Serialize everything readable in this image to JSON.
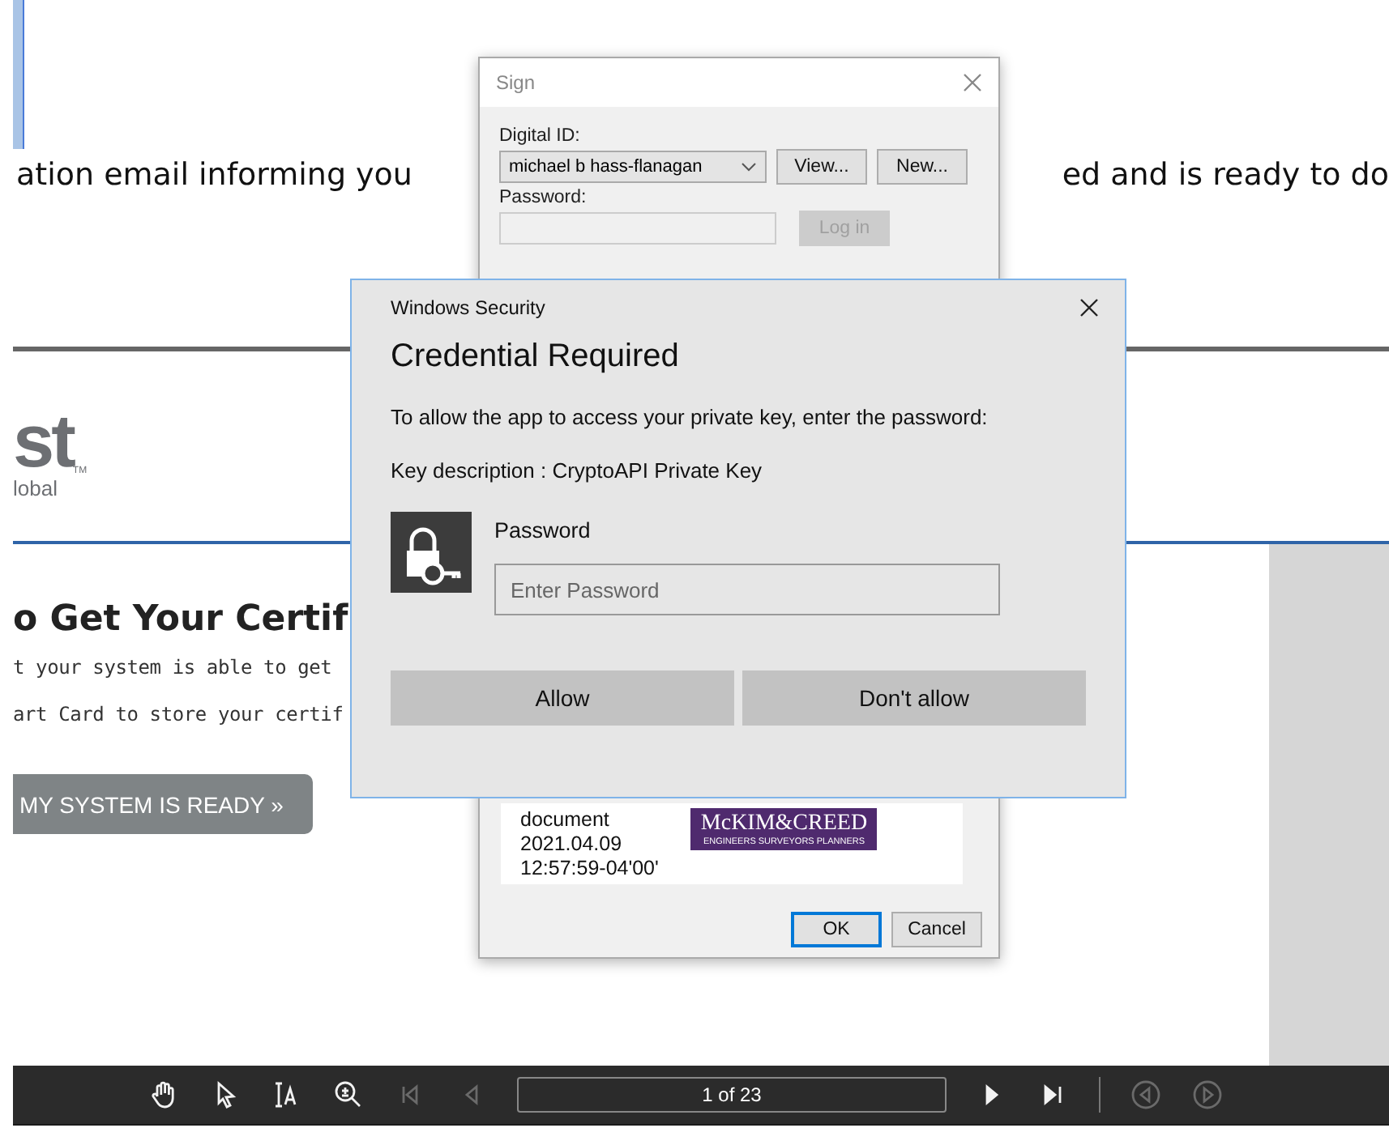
{
  "document": {
    "intro_left": "ation email informing you",
    "intro_right": "ed and is ready to do",
    "logo": {
      "mark": "st",
      "trademark": "TM",
      "tagline": "lobal"
    },
    "heading": "o Get Your Certif",
    "paragraphs": [
      "t your system is able to get",
      "art Card to store your certif"
    ],
    "ready_button": "MY SYSTEM IS READY »"
  },
  "sign_dialog": {
    "title": "Sign",
    "digital_id_label": "Digital ID:",
    "digital_id": "michael b hass-flanagan",
    "id_buttons": [
      {
        "label": "View...",
        "disabled": false
      },
      {
        "label": "New...",
        "disabled": false
      }
    ],
    "password_label": "Password:",
    "login_button": {
      "label": "Log in",
      "disabled": true
    },
    "signature_preview": {
      "lines": [
        "document",
        "2021.04.09",
        "12:57:59-04'00'"
      ],
      "logo_name": "McKIM&CREED",
      "logo_tagline": "ENGINEERS SURVEYORS PLANNERS"
    },
    "footer_buttons": [
      {
        "label": "OK",
        "selected": true
      },
      {
        "label": "Cancel",
        "selected": false
      }
    ]
  },
  "security_dialog": {
    "title": "Windows Security",
    "heading": "Credential Required",
    "message": "To allow the app to access your private key, enter the password:",
    "key_description": "Key description  : CryptoAPI Private Key",
    "password_label": "Password",
    "password_field": {
      "placeholder": "Enter Password"
    },
    "buttons": [
      {
        "label": "Allow"
      },
      {
        "label": "Don't allow"
      }
    ]
  },
  "toolbar": {
    "tools": [
      {
        "kind": "hand",
        "disabled": false
      },
      {
        "kind": "pointer",
        "disabled": false
      },
      {
        "kind": "text-select",
        "disabled": false
      },
      {
        "kind": "zoom",
        "disabled": false
      },
      {
        "kind": "first",
        "disabled": true
      },
      {
        "kind": "prev",
        "disabled": true
      }
    ],
    "page_field": "1 of 23",
    "nav": [
      {
        "kind": "next",
        "disabled": false
      },
      {
        "kind": "last",
        "disabled": false
      },
      {
        "kind": "back",
        "disabled": true
      },
      {
        "kind": "forward",
        "disabled": true
      }
    ]
  }
}
